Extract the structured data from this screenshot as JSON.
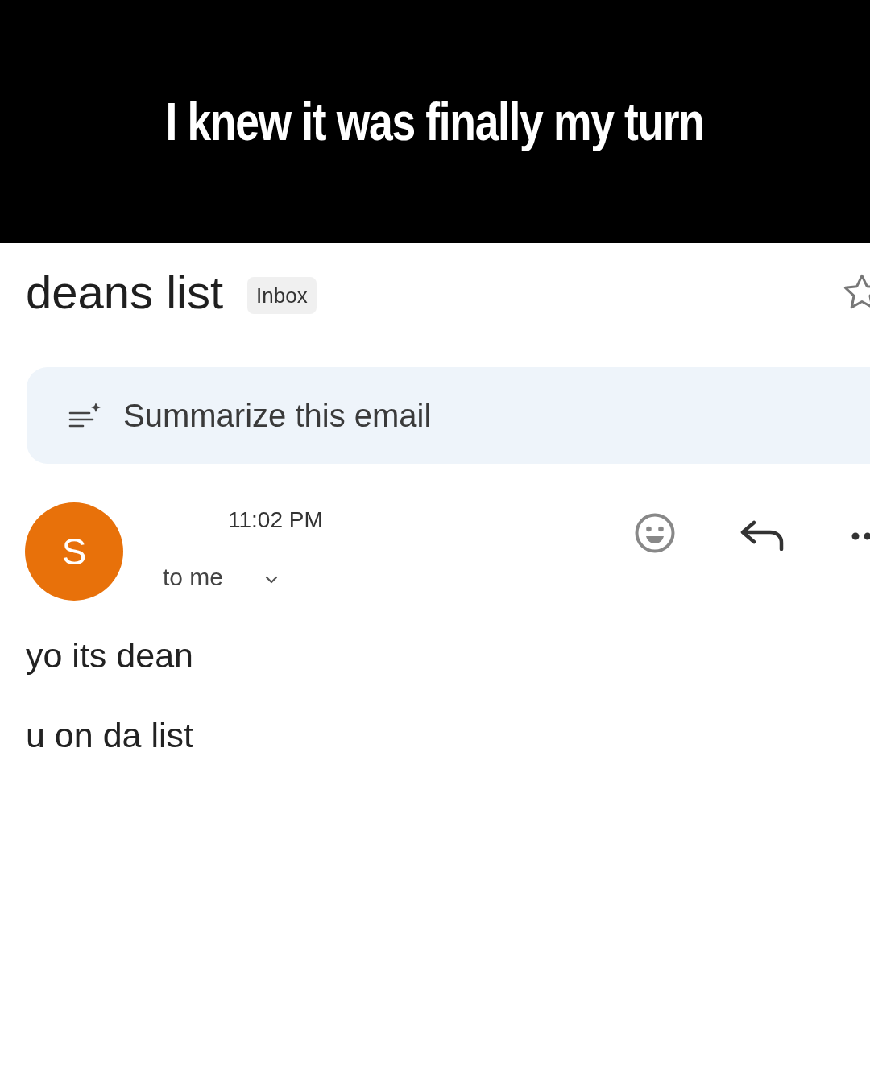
{
  "caption": "I knew it was finally my turn",
  "email": {
    "subject": "deans list",
    "label": "Inbox",
    "starred": false,
    "summarize": "Summarize this email",
    "sender": {
      "initial": "S"
    },
    "time": "11:02 PM",
    "recipient": "to me",
    "body": [
      "yo its dean",
      "u on da list"
    ]
  }
}
